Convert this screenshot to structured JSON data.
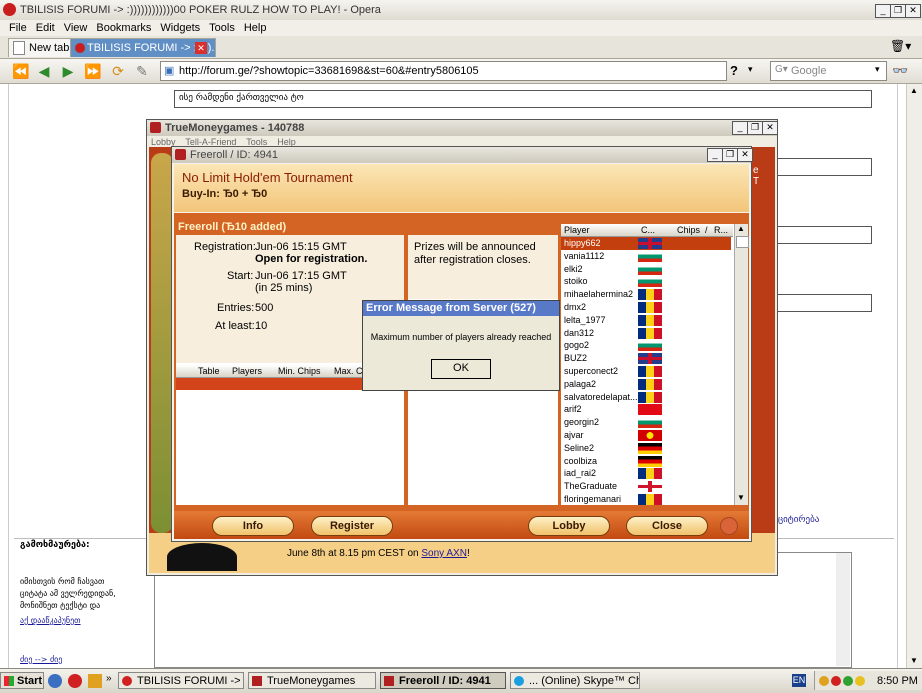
{
  "browser": {
    "title": "TBILISIS FORUMI -> :))))))))))))00 POKER RULZ HOW TO PLAY! - Opera",
    "menu": [
      "File",
      "Edit",
      "View",
      "Bookmarks",
      "Widgets",
      "Tools",
      "Help"
    ],
    "tabs": [
      {
        "label": "New tab"
      },
      {
        "label": "TBILISIS FORUMI -> :))))..."
      }
    ],
    "address": "http://forum.ge/?showtopic=33681698&st=60&#entry5806105",
    "search_placeholder": "Google"
  },
  "forum": {
    "top_input": "ისე რამდენი ქართველია ტო",
    "right_links": "ციტირება",
    "left_header": "გამოხმაურება:",
    "left_text": "იმისთვის რომ ჩასვათ ციტატა ამ ველრედიდან, მონიშნეთ ტექსტი და",
    "left_link": "აქ დააწკაპუნეთ",
    "left_bottom": "ძიე --> ძიე"
  },
  "game_window": {
    "title": "TrueMoneygames - 140788",
    "menu": [
      "Lobby",
      "Tell-A-Friend",
      "Tools",
      "Help"
    ]
  },
  "freeroll": {
    "title": "Freeroll / ID: 4941",
    "header_title": "No Limit Hold'em Tournament",
    "buyin": "Buy-In: Ђ0 + Ђ0",
    "section_title": "Freeroll (Ђ10 added)",
    "registration_label": "Registration:",
    "registration_value": "Jun-06 15:15 GMT",
    "registration_status": "Open for registration.",
    "start_label": "Start:",
    "start_value": "Jun-06 17:15 GMT",
    "start_note": "(in 25 mins)",
    "entries_label": "Entries:",
    "entries_value": "500",
    "atleast_label": "At least:",
    "atleast_value": "10",
    "prizes_text": "Prizes will be announced after registration closes.",
    "table_headers": [
      "Table",
      "Players",
      "Min. Chips",
      "Max. Ch"
    ],
    "player_headers": [
      "Player",
      "C...",
      "Chips",
      "/",
      "R..."
    ],
    "players": [
      {
        "name": "hippy662",
        "flag": "gb"
      },
      {
        "name": "vania1112",
        "flag": "bg"
      },
      {
        "name": "elki2",
        "flag": "bg"
      },
      {
        "name": "stoiko",
        "flag": "bg"
      },
      {
        "name": "mihaelahermina2",
        "flag": "ro"
      },
      {
        "name": "dmx2",
        "flag": "ro"
      },
      {
        "name": "lelta_1977",
        "flag": "ro"
      },
      {
        "name": "dan312",
        "flag": "ro"
      },
      {
        "name": "gogo2",
        "flag": "bg"
      },
      {
        "name": "BUZ2",
        "flag": "gb"
      },
      {
        "name": "superconect2",
        "flag": "ro"
      },
      {
        "name": "palaga2",
        "flag": "ro"
      },
      {
        "name": "salvatoredelapat...",
        "flag": "ro"
      },
      {
        "name": "arif2",
        "flag": "tr"
      },
      {
        "name": "georgin2",
        "flag": "bg"
      },
      {
        "name": "ajvar",
        "flag": "mk"
      },
      {
        "name": "Seline2",
        "flag": "de"
      },
      {
        "name": "coolbiza",
        "flag": "de"
      },
      {
        "name": "iad_rai2",
        "flag": "ro"
      },
      {
        "name": "TheGraduate",
        "flag": "en"
      },
      {
        "name": "floringemanari",
        "flag": "ro"
      }
    ],
    "buttons": {
      "info": "Info",
      "register": "Register",
      "lobby": "Lobby",
      "close": "Close"
    },
    "promo": "June 8th at 8.15 pm CEST on",
    "promo_link": "Sony AXN",
    "promo_end": "!",
    "side_letters": "e\nT"
  },
  "error_dialog": {
    "title": "Error Message from Server (527)",
    "message": "Maximum number of players already reached",
    "ok": "OK"
  },
  "taskbar": {
    "start": "Start",
    "items": [
      "TBILISIS FORUMI -> :))))...",
      "TrueMoneygames",
      "Freeroll / ID: 4941",
      "... (Online) Skype™ Chat"
    ],
    "lang": "EN",
    "time": "8:50 PM"
  },
  "colors": {
    "accent_orange": "#d46423",
    "selected_row": "#c3400e"
  }
}
